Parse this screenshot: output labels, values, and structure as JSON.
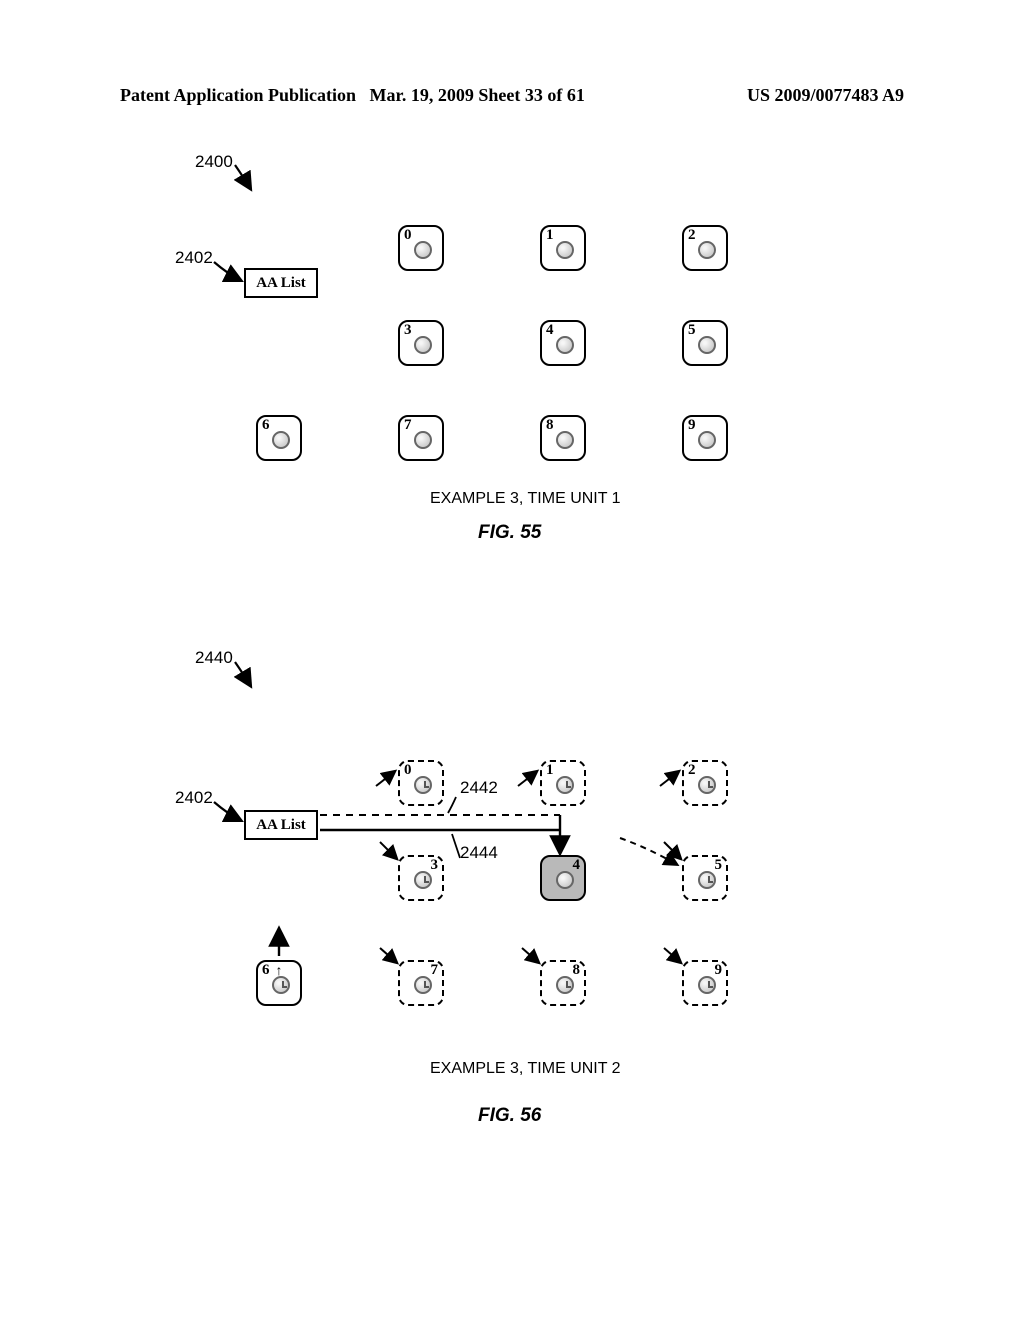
{
  "header": {
    "left": "Patent Application Publication",
    "mid": "Mar. 19, 2009   Sheet 33 of 61",
    "right": "US 2009/0077483 A9"
  },
  "fig55": {
    "ref_2400": "2400",
    "ref_2402": "2402",
    "aa_label": "AA List",
    "nodes": [
      "0",
      "1",
      "2",
      "3",
      "4",
      "5",
      "6",
      "7",
      "8",
      "9"
    ],
    "caption": "EXAMPLE 3, TIME UNIT 1",
    "fignum": "FIG. 55"
  },
  "fig56": {
    "ref_2440": "2440",
    "ref_2402": "2402",
    "ref_2442": "2442",
    "ref_2444": "2444",
    "aa_label": "AA List",
    "nodes": [
      "0",
      "1",
      "2",
      "3",
      "4",
      "5",
      "6",
      "7",
      "8",
      "9"
    ],
    "caption": "EXAMPLE 3, TIME UNIT 2",
    "fignum": "FIG. 56"
  }
}
